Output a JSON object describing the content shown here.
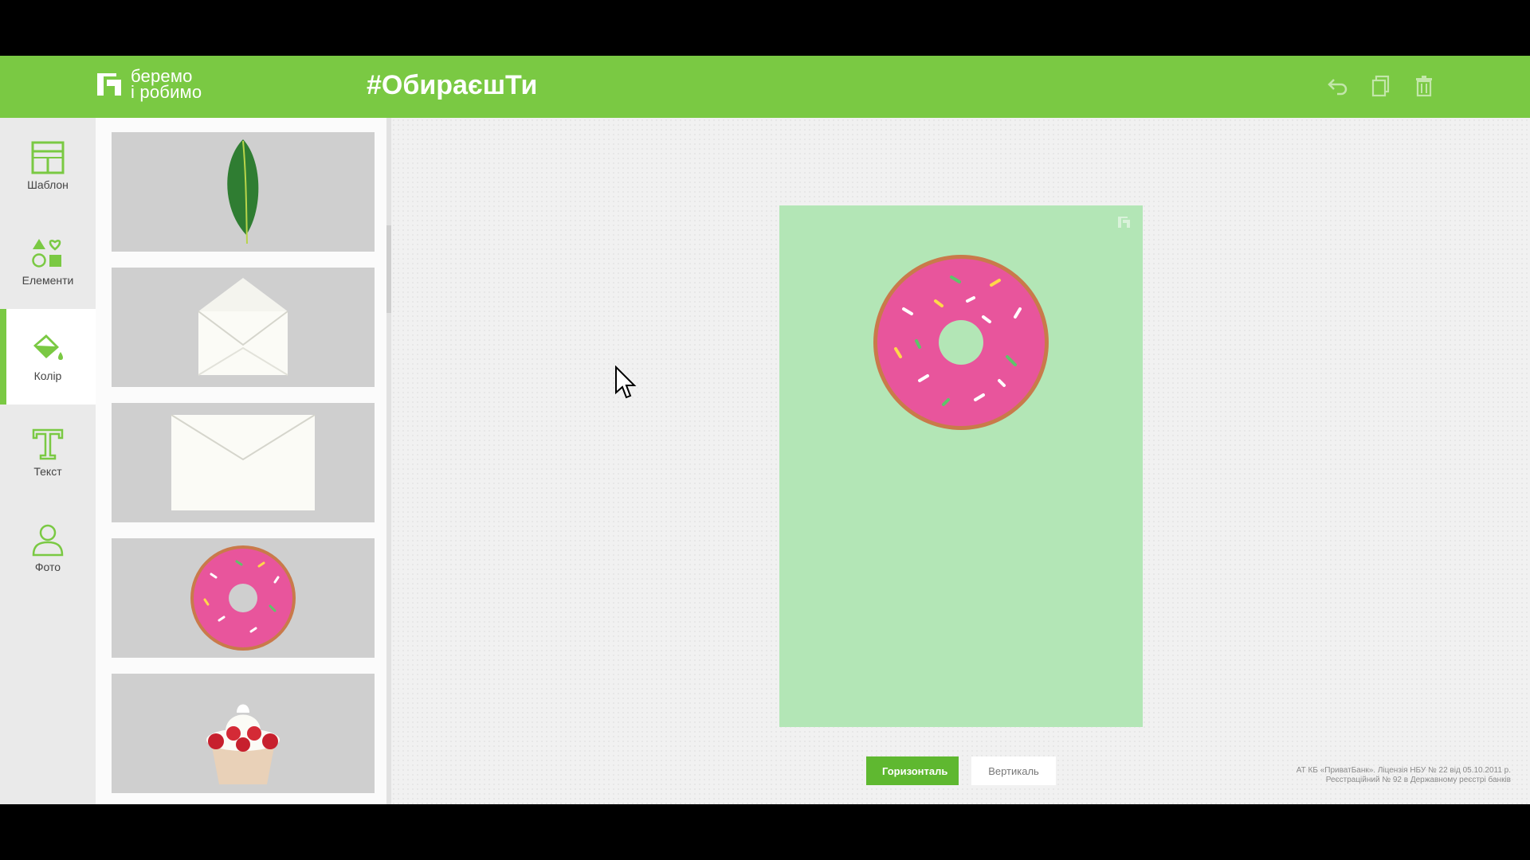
{
  "header": {
    "logo_line1": "беремо",
    "logo_line2": "і робимо",
    "hashtag": "#ОбираєшТи",
    "brand_color": "#7ac943",
    "icons": [
      "undo-icon",
      "copy-icon",
      "trash-icon"
    ]
  },
  "toolbar": {
    "items": [
      {
        "label": "Шаблон",
        "icon": "template-icon"
      },
      {
        "label": "Елементи",
        "icon": "shapes-icon"
      },
      {
        "label": "Колір",
        "icon": "paint-bucket-icon",
        "active": true
      },
      {
        "label": "Текст",
        "icon": "text-icon"
      },
      {
        "label": "Фото",
        "icon": "person-icon"
      }
    ]
  },
  "panel": {
    "thumbnails": [
      "leaf",
      "open-envelope",
      "closed-envelope",
      "donut",
      "cupcake"
    ]
  },
  "canvas": {
    "background_color": "#b3e6b6",
    "element": "donut"
  },
  "orientation": {
    "horizontal_label": "Горизонталь",
    "vertical_label": "Вертикаль",
    "selected": "horizontal"
  },
  "legal": {
    "line1": "АТ КБ «ПриватБанк». Ліцензія НБУ № 22 від 05.10.2011 р.",
    "line2": "Реєстраційний № 92 в Державному реєстрі банків"
  }
}
